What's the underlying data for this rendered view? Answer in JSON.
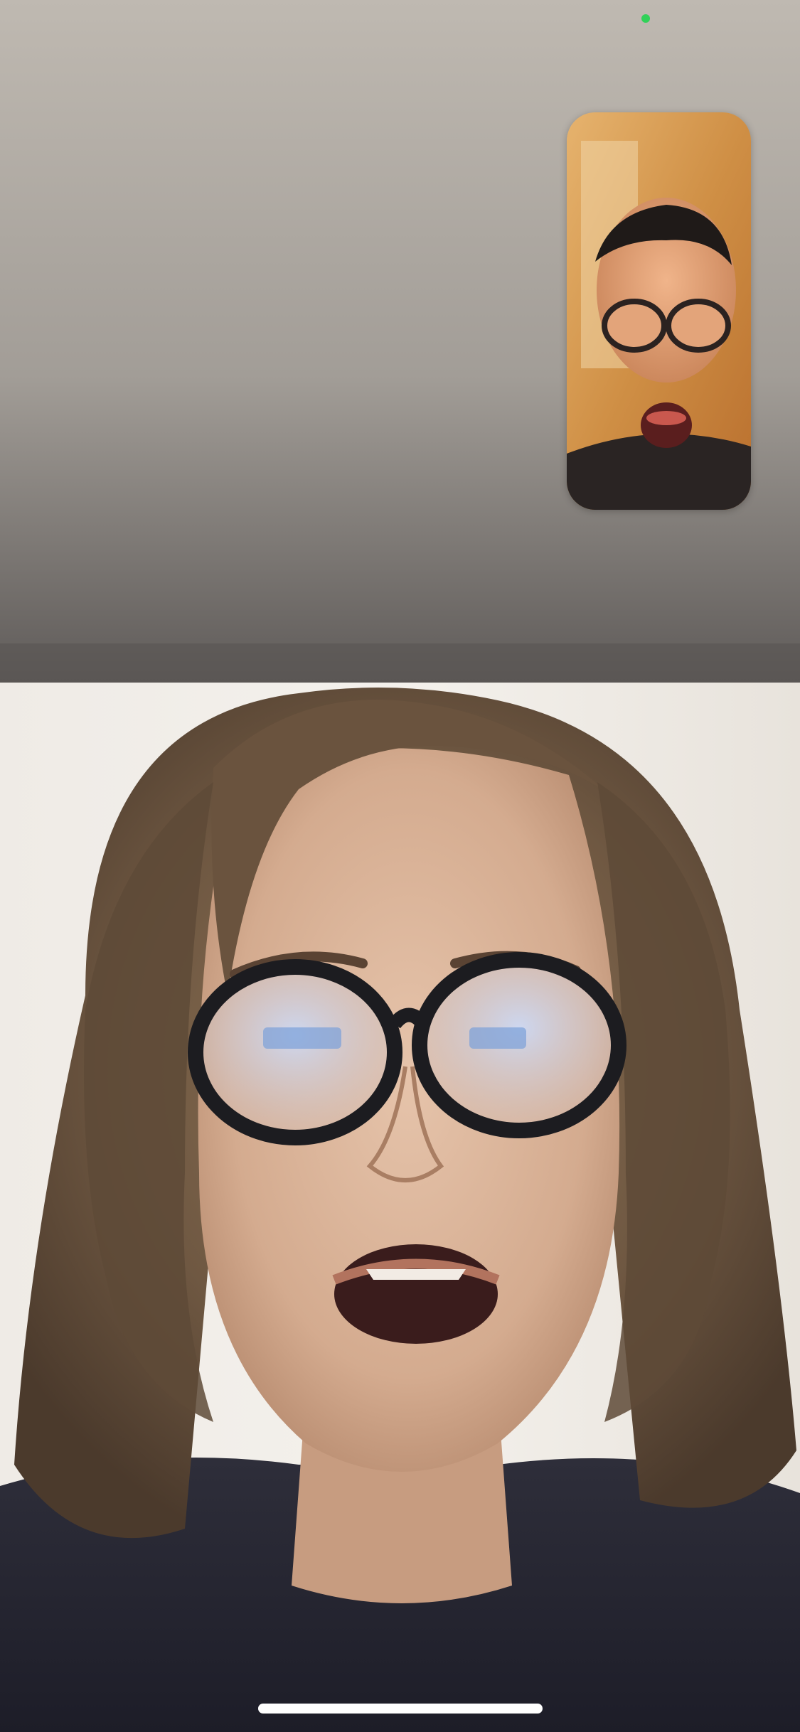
{
  "call": {
    "remote_video_label": "",
    "self_view_label": ""
  },
  "status": {
    "camera_indicator_color": "#31d158"
  },
  "icons": {
    "camera_indicator": "green-dot-icon",
    "home_indicator": "home-indicator-bar"
  }
}
